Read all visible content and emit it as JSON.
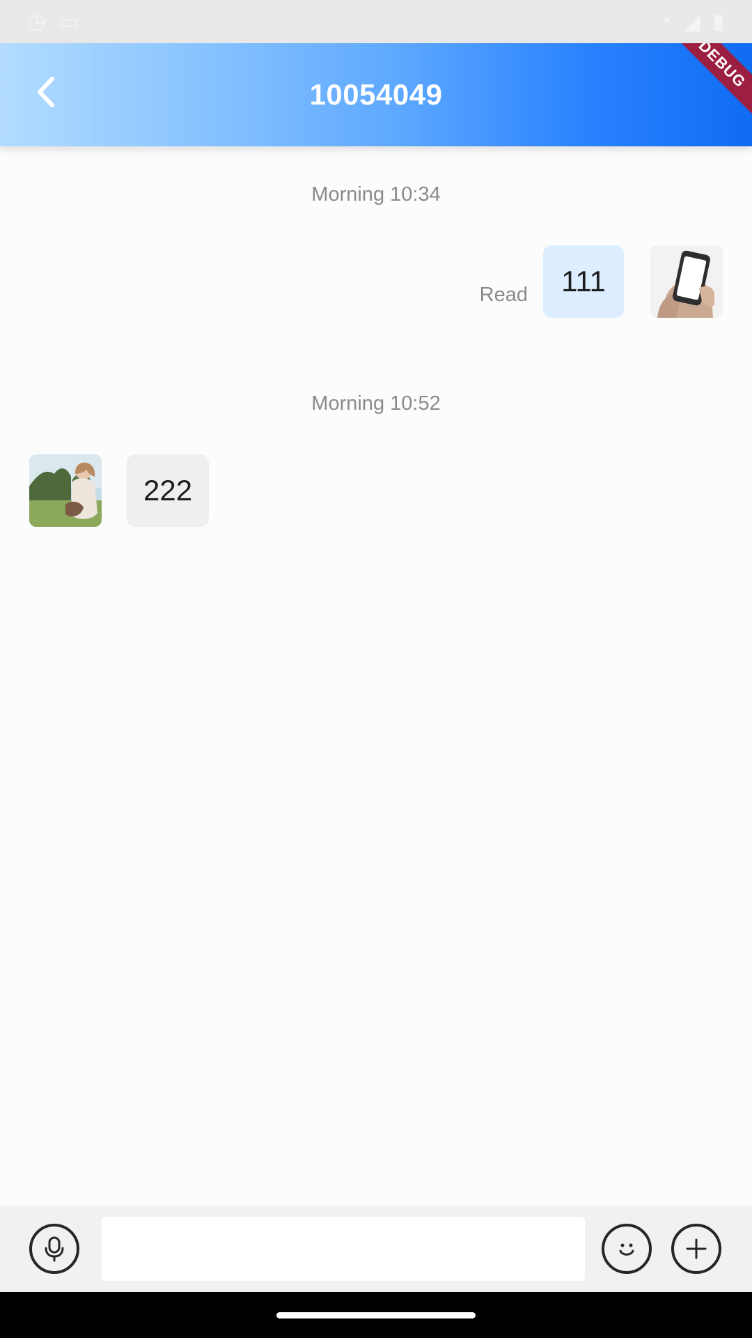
{
  "status_bar": {
    "icons": [
      "status-text-icon",
      "status-sim-icon",
      "wifi-icon",
      "signal-icon",
      "battery-icon"
    ]
  },
  "header": {
    "title": "10054049",
    "debug_label": "DEBUG",
    "back_icon": "chevron-left-icon",
    "gradient": [
      "#b3dcff",
      "#0f6cf2"
    ]
  },
  "chat": {
    "messages": [
      {
        "timestamp": "Morning 10:34",
        "direction": "outgoing",
        "text": "111",
        "status": "Read",
        "avatar": "phone-hand-avatar"
      },
      {
        "timestamp": "Morning 10:52",
        "direction": "incoming",
        "text": "222",
        "avatar": "outdoor-person-avatar"
      }
    ]
  },
  "composer": {
    "input_value": "",
    "icons": {
      "mic": "microphone-icon",
      "emoji": "smiley-icon",
      "add": "plus-icon"
    }
  },
  "colors": {
    "accent": "#1f76f5",
    "outgoing_bubble": "#dceeff",
    "incoming_bubble": "#efefef",
    "timestamp_text": "#8b8b8b"
  }
}
